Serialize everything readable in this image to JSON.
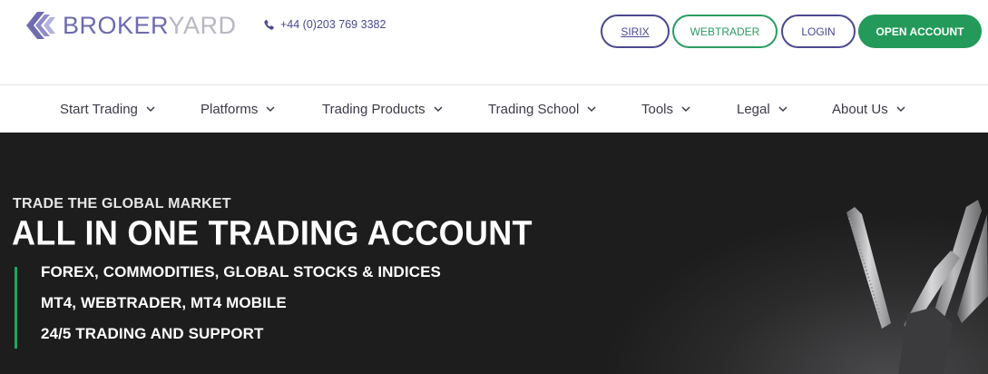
{
  "brand": {
    "name_primary": "BROKER",
    "name_secondary": "YARD",
    "icon": "diamond-logo-icon"
  },
  "contact": {
    "phone": "+44 (0)203 769 3382",
    "icon": "phone-icon"
  },
  "header_buttons": {
    "sirix": "SIRIX",
    "webtrader": "WEBTRADER",
    "login": "LOGIN",
    "open_account": "OPEN ACCOUNT"
  },
  "nav": {
    "items": [
      {
        "label": "Start Trading"
      },
      {
        "label": "Platforms"
      },
      {
        "label": "Trading Products"
      },
      {
        "label": "Trading School"
      },
      {
        "label": "Tools"
      },
      {
        "label": "Legal"
      },
      {
        "label": "About Us"
      }
    ]
  },
  "hero": {
    "kicker": "TRADE THE GLOBAL MARKET",
    "title": "ALL IN ONE TRADING ACCOUNT",
    "features": [
      "FOREX, COMMODITIES, GLOBAL STOCKS & INDICES",
      "MT4, WEBTRADER, MT4 MOBILE",
      "24/5 TRADING AND SUPPORT"
    ]
  },
  "colors": {
    "brand_purple": "#4a4890",
    "brand_green": "#239a5a",
    "hero_bg": "#1d1d1e"
  }
}
